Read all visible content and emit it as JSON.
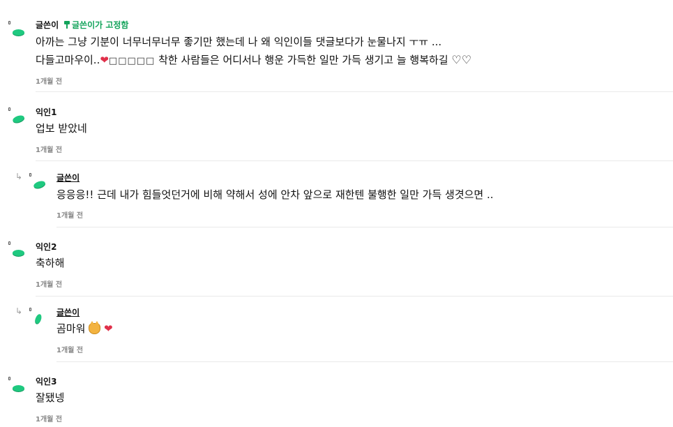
{
  "comments": [
    {
      "nick": "글쓴이",
      "pinned_label": "글쓴이가 고정함",
      "line1": "아까는 그냥 기분이 너무너무너무 좋기만 했는데 나 왜 익인이들 댓글보다가 눈물나지 ㅜㅠ ...",
      "line2_prefix": "다들고마우이..",
      "line2_boxes": "□□□□□",
      "line2_suffix": " 착한 사람들은 어디서나 행운 가득한 일만 가득 생기고 늘 행복하길 ",
      "line2_hearts": "♡♡",
      "time": "1개월 전"
    },
    {
      "nick": "익인1",
      "line1": "업보 받았네",
      "time": "1개월 전"
    },
    {
      "nick": "글쓴이",
      "line1": "응응응!! 근데 내가 힘들엇던거에 비해 약해서 성에 안차 앞으로 재한텐 불행한 일만 가득 생겻으면 ..",
      "time": "1개월 전"
    },
    {
      "nick": "익인2",
      "line1": "축하해",
      "time": "1개월 전"
    },
    {
      "nick": "글쓴이",
      "line1": "곰마워 ",
      "time": "1개월 전"
    },
    {
      "nick": "익인3",
      "line1": "잘됐넹",
      "time": "1개월 전"
    }
  ],
  "icons": {
    "reply": "↳",
    "heart": "❤"
  },
  "colors": {
    "avatar": "#1fc980",
    "pinned": "#12a35a",
    "time": "#888888"
  }
}
